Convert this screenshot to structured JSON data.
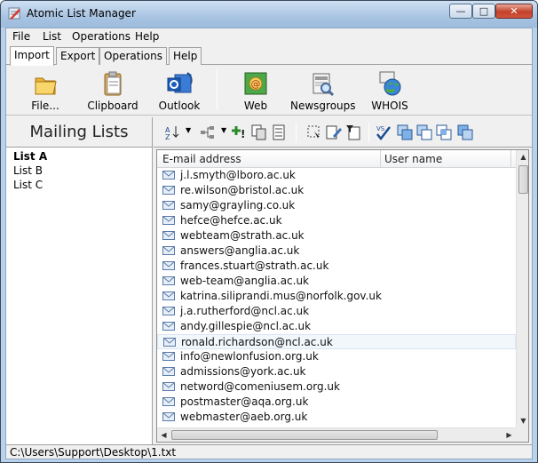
{
  "window": {
    "title": "Atomic List Manager",
    "minimize": "—",
    "maximize": "□",
    "close": "✕"
  },
  "menu": [
    "File",
    "List",
    "Operations",
    "Help"
  ],
  "tabs": [
    "Import",
    "Export",
    "Operations",
    "Help"
  ],
  "ribbon": {
    "file": "File...",
    "clipboard": "Clipboard",
    "outlook": "Outlook",
    "web": "Web",
    "newsgroups": "Newsgroups",
    "whois": "WHOIS"
  },
  "sidebar": {
    "title": "Mailing Lists",
    "lists": [
      "List A",
      "List B",
      "List C"
    ],
    "selected": "List A"
  },
  "table": {
    "columns": [
      "E-mail address",
      "User name"
    ],
    "rows": [
      "j.l.smyth@lboro.ac.uk",
      "re.wilson@bristol.ac.uk",
      "samy@grayling.co.uk",
      "hefce@hefce.ac.uk",
      "webteam@strath.ac.uk",
      "answers@anglia.ac.uk",
      "frances.stuart@strath.ac.uk",
      "web-team@anglia.ac.uk",
      "katrina.siliprandi.mus@norfolk.gov.uk",
      "j.a.rutherford@ncl.ac.uk",
      "andy.gillespie@ncl.ac.uk",
      "ronald.richardson@ncl.ac.uk",
      "info@newlonfusion.org.uk",
      "admissions@york.ac.uk",
      "netword@comeniusem.org.uk",
      "postmaster@aqa.org.uk",
      "webmaster@aeb.org.uk"
    ],
    "selected_row": "ronald.richardson@ncl.ac.uk"
  },
  "status": {
    "path": "C:\\Users\\Support\\Desktop\\1.txt"
  }
}
